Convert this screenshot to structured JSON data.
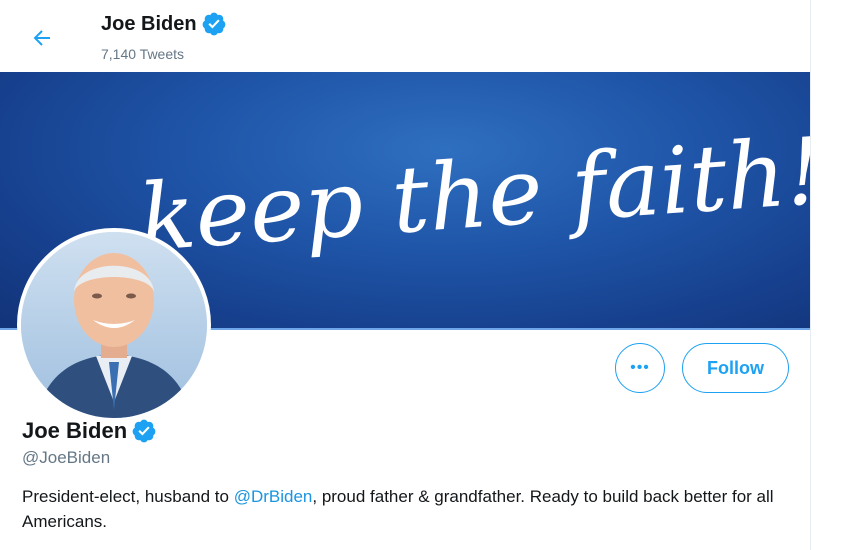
{
  "header": {
    "name": "Joe Biden",
    "tweet_count": "7,140 Tweets"
  },
  "banner": {
    "script_text": "keep the faith!",
    "background_color": "#1f55a8"
  },
  "profile": {
    "name": "Joe Biden",
    "handle": "@JoeBiden",
    "verified": true,
    "bio": {
      "part1": "President-elect, husband to ",
      "mention": "@DrBiden",
      "part2": ", proud father & grandfather. Ready to build back better for all Americans."
    }
  },
  "actions": {
    "more_label": "•••",
    "follow_label": "Follow"
  },
  "icons": {
    "back": "arrow-left-icon",
    "verified": "verified-badge-icon",
    "more": "more-options-icon"
  },
  "colors": {
    "accent": "#1da1f2",
    "text": "#14171a",
    "secondary": "#657786"
  }
}
